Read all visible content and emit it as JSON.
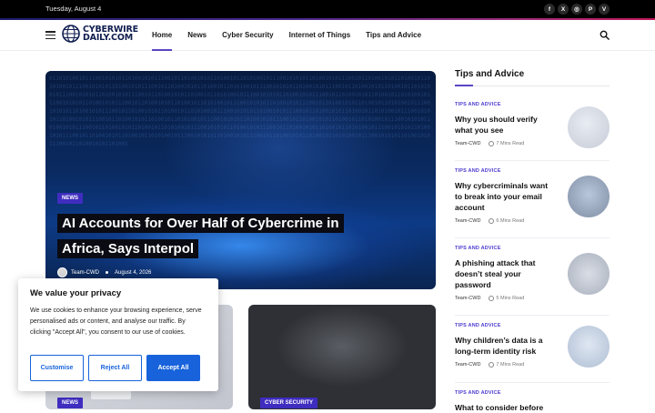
{
  "topbar": {
    "date": "Tuesday, August 4",
    "socials": [
      {
        "icon": "facebook-icon",
        "glyph": "f"
      },
      {
        "icon": "x-twitter-icon",
        "glyph": "X"
      },
      {
        "icon": "instagram-icon",
        "glyph": "◎"
      },
      {
        "icon": "pinterest-icon",
        "glyph": "P"
      },
      {
        "icon": "vimeo-icon",
        "glyph": "V"
      }
    ]
  },
  "header": {
    "logo_line1": "CYBERWIRE",
    "logo_line2": "DAILY.COM",
    "nav": [
      "Home",
      "News",
      "Cyber Security",
      "Internet of Things",
      "Tips and Advice"
    ],
    "active_nav": "Home",
    "accent_color": "#5a45c4"
  },
  "hero": {
    "category": "NEWS",
    "title": "AI Accounts for Over Half of Cybercrime in Africa, Says Interpol",
    "author": "Team-CWD",
    "date": "August 4, 2026"
  },
  "cards": [
    {
      "category": "NEWS"
    },
    {
      "category": "CYBER SECURITY"
    }
  ],
  "cookie": {
    "title": "We value your privacy",
    "text": "We use cookies to enhance your browsing experience, serve personalised ads or content, and analyse our traffic. By clicking \"Accept All\", you consent to our use of cookies.",
    "customise": "Customise",
    "reject": "Reject All",
    "accept": "Accept All",
    "button_color": "#1863dc"
  },
  "sidebar": {
    "heading": "Tips and Advice",
    "items": [
      {
        "category": "TIPS AND ADVICE",
        "title": "Why you should verify what you see",
        "author": "Team-CWD",
        "read": "7 Mins Read"
      },
      {
        "category": "TIPS AND ADVICE",
        "title": "Why cybercriminals want to break into your email account",
        "author": "Team-CWD",
        "read": "6 Mins Read"
      },
      {
        "category": "TIPS AND ADVICE",
        "title": "A phishing attack that doesn’t steal your password",
        "author": "Team-CWD",
        "read": "5 Mins Read"
      },
      {
        "category": "TIPS AND ADVICE",
        "title": "Why children’s data is a long-term identity risk",
        "author": "Team-CWD",
        "read": "7 Mins Read"
      },
      {
        "category": "TIPS AND ADVICE",
        "title": "What to consider before"
      }
    ]
  }
}
